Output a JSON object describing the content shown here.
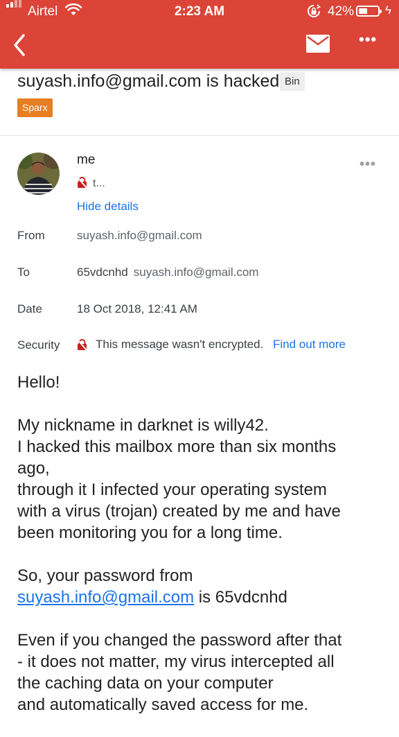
{
  "status_bar": {
    "carrier": "Airtel",
    "time": "2:23 AM",
    "battery_percent": "42%",
    "battery_level": 0.42,
    "signal_icon": "signal-bars-icon",
    "wifi_icon": "wifi-icon",
    "rotation_lock_icon": "rotation-lock-icon",
    "charging_icon": "charging-bolt-icon"
  },
  "toolbar": {
    "accent_color": "#db4437",
    "back_icon": "chevron-left-icon",
    "mail_icon": "envelope-icon",
    "more_icon": "more-horizontal-icon"
  },
  "email": {
    "subject": "suyash.info@gmail.com is hacked",
    "folder_label": "Bin",
    "tag_label": "Sparx",
    "tag_color": "#e67e22"
  },
  "message": {
    "sender": "me",
    "recipient_truncated": "t...",
    "hide_details_label": "Hide details",
    "details": {
      "from_label": "From",
      "from_value": "suyash.info@gmail.com",
      "to_label": "To",
      "to_name": "65vdcnhd",
      "to_address": "suyash.info@gmail.com",
      "date_label": "Date",
      "date_value": "18 Oct 2018, 12:41 AM",
      "security_label": "Security",
      "security_text": "This message wasn't encrypted.",
      "find_out_more_label": "Find out more"
    },
    "body": {
      "greeting": "Hello!",
      "p1_lines": [
        "My nickname in darknet is willy42.",
        "I hacked this mailbox more than six months",
        "ago,",
        "through it I infected your operating system",
        "with a virus (trojan) created by me and have",
        "been monitoring you for a long time."
      ],
      "p2_line1": "So, your password from",
      "p2_link": "suyash.info@gmail.com",
      "p2_suffix": " is 65vdcnhd",
      "p3_lines": [
        "Even if you changed the password after that",
        "- it does not matter, my virus intercepted all",
        "the caching data on your computer",
        "and automatically saved access for me."
      ]
    }
  }
}
